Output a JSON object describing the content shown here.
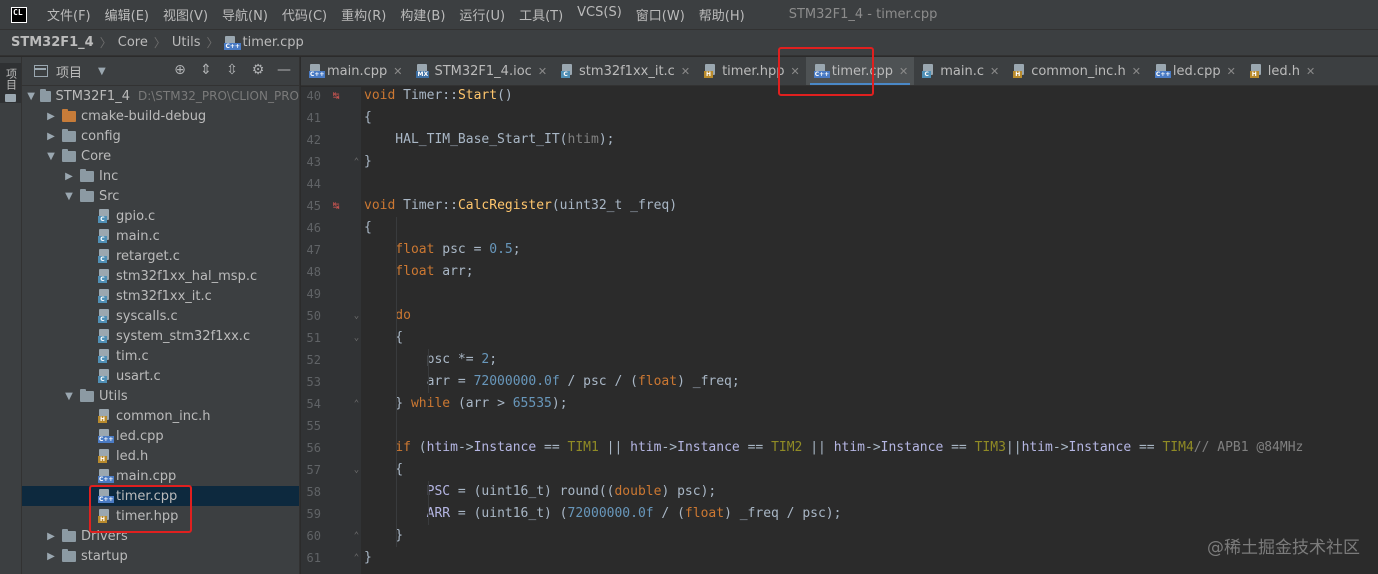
{
  "menubar": {
    "logo": "CL",
    "items": [
      "文件(F)",
      "编辑(E)",
      "视图(V)",
      "导航(N)",
      "代码(C)",
      "重构(R)",
      "构建(B)",
      "运行(U)",
      "工具(T)",
      "VCS(S)",
      "窗口(W)",
      "帮助(H)"
    ],
    "window_title": "STM32F1_4 - timer.cpp"
  },
  "breadcrumb": {
    "project": "STM32F1_4",
    "items": [
      "Core",
      "Utils",
      "timer.cpp"
    ]
  },
  "left_strip": {
    "label": "项目"
  },
  "project_panel": {
    "title": "项目",
    "tree": [
      {
        "label": "STM32F1_4",
        "path": "D:\\STM32_PRO\\CLION_PRO",
        "type": "folder",
        "arrow": "down",
        "depth": 0
      },
      {
        "label": "cmake-build-debug",
        "type": "folder-orange",
        "arrow": "right",
        "depth": 1
      },
      {
        "label": "config",
        "type": "folder",
        "arrow": "right",
        "depth": 1
      },
      {
        "label": "Core",
        "type": "folder",
        "arrow": "down",
        "depth": 1
      },
      {
        "label": "Inc",
        "type": "folder",
        "arrow": "right",
        "depth": 2
      },
      {
        "label": "Src",
        "type": "folder",
        "arrow": "down",
        "depth": 2
      },
      {
        "label": "gpio.c",
        "type": "c",
        "depth": 3
      },
      {
        "label": "main.c",
        "type": "c",
        "depth": 3
      },
      {
        "label": "retarget.c",
        "type": "c",
        "depth": 3
      },
      {
        "label": "stm32f1xx_hal_msp.c",
        "type": "c",
        "depth": 3
      },
      {
        "label": "stm32f1xx_it.c",
        "type": "c",
        "depth": 3
      },
      {
        "label": "syscalls.c",
        "type": "c",
        "depth": 3
      },
      {
        "label": "system_stm32f1xx.c",
        "type": "c",
        "depth": 3
      },
      {
        "label": "tim.c",
        "type": "c",
        "depth": 3
      },
      {
        "label": "usart.c",
        "type": "c",
        "depth": 3
      },
      {
        "label": "Utils",
        "type": "folder",
        "arrow": "down",
        "depth": 2
      },
      {
        "label": "common_inc.h",
        "type": "h",
        "depth": 3
      },
      {
        "label": "led.cpp",
        "type": "cpp",
        "depth": 3
      },
      {
        "label": "led.h",
        "type": "h",
        "depth": 3
      },
      {
        "label": "main.cpp",
        "type": "cpp",
        "depth": 3
      },
      {
        "label": "timer.cpp",
        "type": "cpp",
        "depth": 3,
        "selected": true
      },
      {
        "label": "timer.hpp",
        "type": "hpp",
        "depth": 3
      },
      {
        "label": "Drivers",
        "type": "folder",
        "arrow": "right",
        "depth": 1
      },
      {
        "label": "startup",
        "type": "folder",
        "arrow": "right",
        "depth": 1
      }
    ]
  },
  "tabs": [
    {
      "label": "main.cpp",
      "type": "cpp"
    },
    {
      "label": "STM32F1_4.ioc",
      "type": "ioc"
    },
    {
      "label": "stm32f1xx_it.c",
      "type": "c"
    },
    {
      "label": "timer.hpp",
      "type": "hpp"
    },
    {
      "label": "timer.cpp",
      "type": "cpp",
      "active": true
    },
    {
      "label": "main.c",
      "type": "c"
    },
    {
      "label": "common_inc.h",
      "type": "h"
    },
    {
      "label": "led.cpp",
      "type": "cpp"
    },
    {
      "label": "led.h",
      "type": "h"
    }
  ],
  "code": {
    "lines": [
      {
        "n": "40",
        "marker": true,
        "fold": "",
        "tokens": [
          [
            "kw",
            "void "
          ],
          [
            "",
            "Timer::"
          ],
          [
            "fn",
            "Start"
          ],
          [
            "",
            "()"
          ]
        ]
      },
      {
        "n": "41",
        "tokens": [
          [
            "",
            "{"
          ]
        ]
      },
      {
        "n": "42",
        "tokens": [
          [
            "",
            "    HAL_TIM_Base_Start_IT("
          ],
          [
            "cm",
            "htim"
          ],
          [
            "",
            "); "
          ]
        ]
      },
      {
        "n": "43",
        "fold": "end",
        "tokens": [
          [
            "",
            "}"
          ]
        ]
      },
      {
        "n": "44",
        "tokens": []
      },
      {
        "n": "45",
        "marker": true,
        "tokens": [
          [
            "kw",
            "void "
          ],
          [
            "",
            "Timer::"
          ],
          [
            "fn",
            "CalcRegister"
          ],
          [
            "",
            "(uint32_t _freq)"
          ]
        ]
      },
      {
        "n": "46",
        "tokens": [
          [
            "",
            "{"
          ]
        ]
      },
      {
        "n": "47",
        "tokens": [
          [
            "kw",
            "    float "
          ],
          [
            "",
            "psc = "
          ],
          [
            "num",
            "0.5"
          ],
          [
            "",
            ";"
          ]
        ]
      },
      {
        "n": "48",
        "tokens": [
          [
            "kw",
            "    float "
          ],
          [
            "",
            "arr;"
          ]
        ]
      },
      {
        "n": "49",
        "tokens": []
      },
      {
        "n": "50",
        "fold": "start",
        "tokens": [
          [
            "kw",
            "    do"
          ]
        ]
      },
      {
        "n": "51",
        "fold": "start",
        "tokens": [
          [
            "",
            "    {"
          ]
        ]
      },
      {
        "n": "52",
        "tokens": [
          [
            "",
            "        psc *= "
          ],
          [
            "num",
            "2"
          ],
          [
            "",
            ";"
          ]
        ]
      },
      {
        "n": "53",
        "tokens": [
          [
            "",
            "        arr = "
          ],
          [
            "num",
            "72000000.0f"
          ],
          [
            "",
            " / psc / ("
          ],
          [
            "kw",
            "float"
          ],
          [
            "",
            ") _freq;"
          ]
        ]
      },
      {
        "n": "54",
        "fold": "end",
        "tokens": [
          [
            "",
            "    } "
          ],
          [
            "kw",
            "while "
          ],
          [
            "",
            "(arr > "
          ],
          [
            "num",
            "65535"
          ],
          [
            "",
            ");"
          ]
        ]
      },
      {
        "n": "55",
        "tokens": []
      },
      {
        "n": "56",
        "tokens": [
          [
            "kw",
            "    if "
          ],
          [
            "",
            "("
          ],
          [
            "ty",
            "htim"
          ],
          [
            "",
            "->"
          ],
          [
            "ty",
            "Instance"
          ],
          [
            "",
            " == "
          ],
          [
            "macro",
            "TIM1"
          ],
          [
            "",
            " || "
          ],
          [
            "ty",
            "htim"
          ],
          [
            "",
            "->"
          ],
          [
            "ty",
            "Instance"
          ],
          [
            "",
            " == "
          ],
          [
            "macro",
            "TIM2"
          ],
          [
            "",
            " || "
          ],
          [
            "ty",
            "htim"
          ],
          [
            "",
            "->"
          ],
          [
            "ty",
            "Instance"
          ],
          [
            "",
            " == "
          ],
          [
            "macro",
            "TIM3"
          ],
          [
            "",
            "||"
          ],
          [
            "ty",
            "htim"
          ],
          [
            "",
            "->"
          ],
          [
            "ty",
            "Instance"
          ],
          [
            "",
            " == "
          ],
          [
            "macro",
            "TIM4"
          ],
          [
            ") "
          ],
          [
            "cm",
            "// APB1 @84MHz"
          ]
        ]
      },
      {
        "n": "57",
        "fold": "start",
        "tokens": [
          [
            "",
            "    {"
          ]
        ]
      },
      {
        "n": "58",
        "tokens": [
          [
            "",
            "        "
          ],
          [
            "ty",
            "PSC"
          ],
          [
            "",
            " = (uint16_t) round(("
          ],
          [
            "kw",
            "double"
          ],
          [
            "",
            ") psc);"
          ]
        ]
      },
      {
        "n": "59",
        "tokens": [
          [
            "",
            "        "
          ],
          [
            "ty",
            "ARR"
          ],
          [
            "",
            " = (uint16_t) ("
          ],
          [
            "num",
            "72000000.0f"
          ],
          [
            "",
            " / ("
          ],
          [
            "kw",
            "float"
          ],
          [
            "",
            ") _freq / psc);"
          ]
        ]
      },
      {
        "n": "60",
        "fold": "end",
        "tokens": [
          [
            "",
            "    }"
          ]
        ]
      },
      {
        "n": "61",
        "fold": "end",
        "tokens": [
          [
            "",
            "}"
          ]
        ]
      }
    ]
  },
  "watermark": "@稀土掘金技术社区"
}
